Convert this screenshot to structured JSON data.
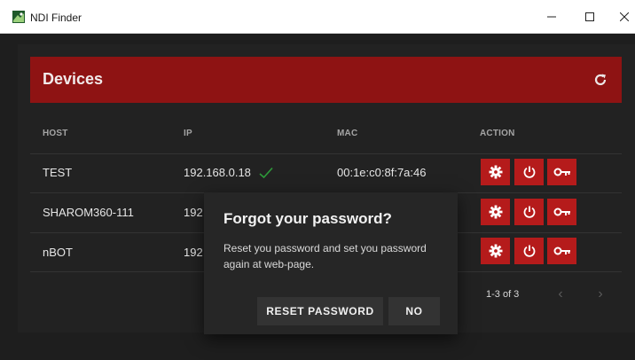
{
  "window": {
    "title": "NDI Finder",
    "minimize_glyph": "–",
    "maximize_glyph": "☐",
    "close_glyph": "✕"
  },
  "devices_panel": {
    "title": "Devices",
    "refresh_icon": "refresh-icon"
  },
  "table": {
    "columns": [
      "HOST",
      "IP",
      "MAC",
      "ACTION"
    ],
    "rows": [
      {
        "host": "TEST",
        "ip": "192.168.0.18",
        "ip_ok": true,
        "mac": "00:1e:c0:8f:7a:46"
      },
      {
        "host": "SHAROM360-111",
        "ip": "192",
        "mac": ""
      },
      {
        "host": "nBOT",
        "ip": "192",
        "mac": ""
      }
    ],
    "action_icons": [
      "gear-icon",
      "power-icon",
      "key-icon"
    ]
  },
  "pagination": {
    "range": "1-3 of 3",
    "prev": "‹",
    "next": "›"
  },
  "dialog": {
    "title": "Forgot your password?",
    "body": "Reset you password and set you password again at web-page.",
    "reset_label": "RESET PASSWORD",
    "no_label": "NO"
  },
  "colors": {
    "header_bg": "#8e1313",
    "action_bg": "#b51b1b",
    "check": "#2e9b3a"
  }
}
